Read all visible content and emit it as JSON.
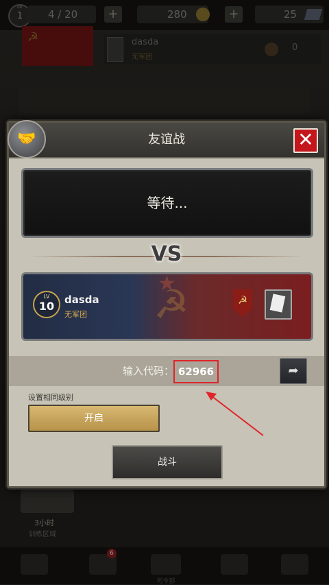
{
  "topbar": {
    "level": "1",
    "level_caption": "LV",
    "troops": "4 / 20",
    "gold": "280",
    "gems": "25",
    "plus_label": "+"
  },
  "profile": {
    "name": "dasda",
    "legion": "无军团",
    "medals": "0"
  },
  "background": {
    "timer": "3小时",
    "area": "训练区域",
    "badge_count": "6",
    "nav_hq": "司令部"
  },
  "dialog": {
    "title": "友谊战",
    "close_label": "✕",
    "waiting_text": "等待...",
    "vs_text": "VS",
    "opponent": {
      "level_caption": "LV",
      "level": "10",
      "name": "dasda",
      "legion": "无军团"
    },
    "code_label": "输入代码：",
    "code_value": "62966",
    "set_level_label": "设置相同级别",
    "open_button": "开启",
    "fight_button": "战斗"
  },
  "colors": {
    "close_red": "#c4161c",
    "highlight_red": "#e0242a",
    "gold_button": "#d8b871"
  },
  "icons": [
    "handshake-icon",
    "close-icon",
    "hammer-sickle-icon",
    "star-icon",
    "share-icon",
    "gold-coin-icon",
    "gem-icon",
    "emblem-icon",
    "card-icon"
  ]
}
